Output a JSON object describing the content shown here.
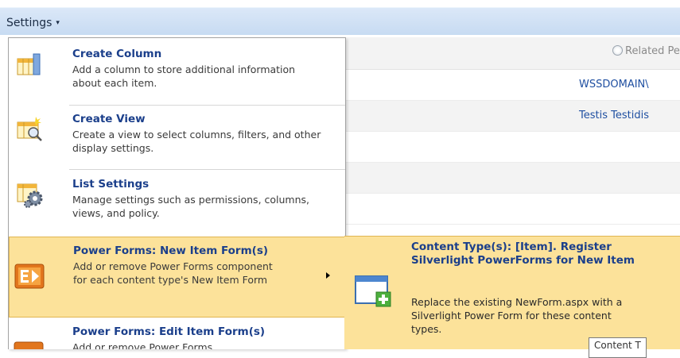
{
  "toolbar": {
    "settings_label": "Settings",
    "caret": "▾"
  },
  "list": {
    "header": "Related Perso",
    "rows": [
      {
        "value": "WSSDOMAIN\\"
      },
      {
        "value": "Testis Testidis"
      }
    ]
  },
  "menu": {
    "items": [
      {
        "title": "Create Column",
        "desc": "Add a column to store additional information about each item.",
        "icon": "column-icon"
      },
      {
        "title": "Create View",
        "desc": "Create a view to select columns, filters, and other display settings.",
        "icon": "view-icon"
      },
      {
        "title": "List Settings",
        "desc": "Manage settings such as permissions, columns, views, and policy.",
        "icon": "list-settings-icon"
      },
      {
        "title": "Power Forms: New Item Form(s)",
        "desc": "Add or remove Power Forms component for each content type's New Item Form",
        "icon": "power-forms-icon"
      },
      {
        "title": "Power Forms: Edit Item Form(s)",
        "desc": "Add or remove Power Forms",
        "icon": "power-forms-icon"
      }
    ]
  },
  "submenu": {
    "title": "Content Type(s): [Item]. Register Silverlight PowerForms for New Item",
    "desc": "Replace the existing NewForm.aspx with a Silverlight Power Form for these content types.",
    "icon": "add-form-icon"
  },
  "tooltip": {
    "text": "Content T"
  },
  "colors": {
    "highlight": "#fce29a",
    "link": "#1b3f8b",
    "toolbar": "#c7dbf2"
  }
}
